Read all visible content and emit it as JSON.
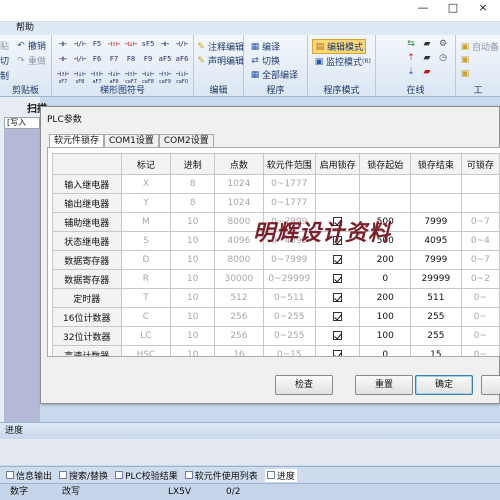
{
  "menu": {
    "help": "帮助"
  },
  "window_buttons": [
    "—",
    "□",
    "×"
  ],
  "ribbon": {
    "clipboard": {
      "label": "剪贴板",
      "paste": "贴",
      "undo": "撤销",
      "cut": "切",
      "redo": "重做",
      "copy": "制"
    },
    "ladder": {
      "label": "梯形图符号",
      "cells_row1": [
        "⊣⊢",
        "⊣/⊢",
        "F5",
        "⊣↑⊢",
        "⊣↓⊢",
        "sF5",
        "⊣⊢",
        "⊣/⊢"
      ],
      "cells_row2": [
        "⊣⊢",
        "⊣/⊢",
        "F6",
        "F7",
        "F8",
        "F9",
        "aF5",
        "aF6"
      ],
      "cells_row3": [
        "⊣↑⊢",
        "⊣↓⊢",
        "⊣↑⊢",
        "⊣↓⊢",
        "⊣↑⊢",
        "⊣↓⊢",
        "⊣↑⊢",
        "⊣↓⊢"
      ],
      "subs_row3": [
        "sF7",
        "sF8",
        "aF7",
        "aF8",
        "caF7",
        "caF8",
        "caF9",
        "caF0"
      ]
    },
    "edit": {
      "label": "编辑",
      "comment_edit": "注释编辑",
      "statement_edit": "声明编辑"
    },
    "program": {
      "label": "程序",
      "compile": "编译",
      "switch": "切换",
      "compile_all": "全部编译"
    },
    "program_mode": {
      "label": "程序模式",
      "edit_mode": "编辑模式",
      "monitor_mode": "监控模式",
      "monitor_suffix": "(R)"
    },
    "online": {
      "label": "在线"
    },
    "tools": {
      "auto_save": "自动备",
      "more_label": "工"
    }
  },
  "workspace": {
    "tab_title": "扫描",
    "subtab": "[写入"
  },
  "dialog": {
    "title": "PLC参数",
    "tabs": [
      "软元件锁存",
      "COM1设置",
      "COM2设置"
    ],
    "headers": [
      "",
      "标记",
      "进制",
      "点数",
      "软元件范围",
      "启用锁存",
      "锁存起始",
      "锁存结束",
      "可锁存"
    ],
    "rows": [
      {
        "name": "输入继电器",
        "mark": "X",
        "base": "8",
        "points": "1024",
        "range": "0~1777",
        "latch": false,
        "start": "",
        "end": "",
        "can": ""
      },
      {
        "name": "输出继电器",
        "mark": "Y",
        "base": "8",
        "points": "1024",
        "range": "0~1777",
        "latch": false,
        "start": "",
        "end": "",
        "can": ""
      },
      {
        "name": "辅助继电器",
        "mark": "M",
        "base": "10",
        "points": "8000",
        "range": "0~7999",
        "latch": true,
        "start": "500",
        "end": "7999",
        "can": "0~7"
      },
      {
        "name": "状态继电器",
        "mark": "S",
        "base": "10",
        "points": "4096",
        "range": "0~4095",
        "latch": true,
        "start": "500",
        "end": "4095",
        "can": "0~4"
      },
      {
        "name": "数据寄存器",
        "mark": "D",
        "base": "10",
        "points": "8000",
        "range": "0~7999",
        "latch": true,
        "start": "200",
        "end": "7999",
        "can": "0~7"
      },
      {
        "name": "数据寄存器",
        "mark": "R",
        "base": "10",
        "points": "30000",
        "range": "0~29999",
        "latch": true,
        "start": "0",
        "end": "29999",
        "can": "0~2"
      },
      {
        "name": "定时器",
        "mark": "T",
        "base": "10",
        "points": "512",
        "range": "0~511",
        "latch": true,
        "start": "200",
        "end": "511",
        "can": "0~"
      },
      {
        "name": "16位计数器",
        "mark": "C",
        "base": "10",
        "points": "256",
        "range": "0~255",
        "latch": true,
        "start": "100",
        "end": "255",
        "can": "0~"
      },
      {
        "name": "32位计数器",
        "mark": "LC",
        "base": "10",
        "points": "256",
        "range": "0~255",
        "latch": true,
        "start": "100",
        "end": "255",
        "can": "0~"
      },
      {
        "name": "高速计数器",
        "mark": "HSC",
        "base": "10",
        "points": "16",
        "range": "0~15",
        "latch": true,
        "start": "0",
        "end": "15",
        "can": "0~"
      }
    ],
    "buttons": {
      "check": "检查",
      "reset": "重置",
      "ok": "确定"
    }
  },
  "watermark": "明辉设计资料",
  "bottom": {
    "progress_title": "进度",
    "tabs": [
      "信息输出",
      "搜索/替换",
      "PLC校验结果",
      "软元件使用列表",
      "进度"
    ],
    "status": {
      "mode": "数字",
      "edit": "改写",
      "model": "LX5V",
      "pos": "0/2"
    }
  }
}
